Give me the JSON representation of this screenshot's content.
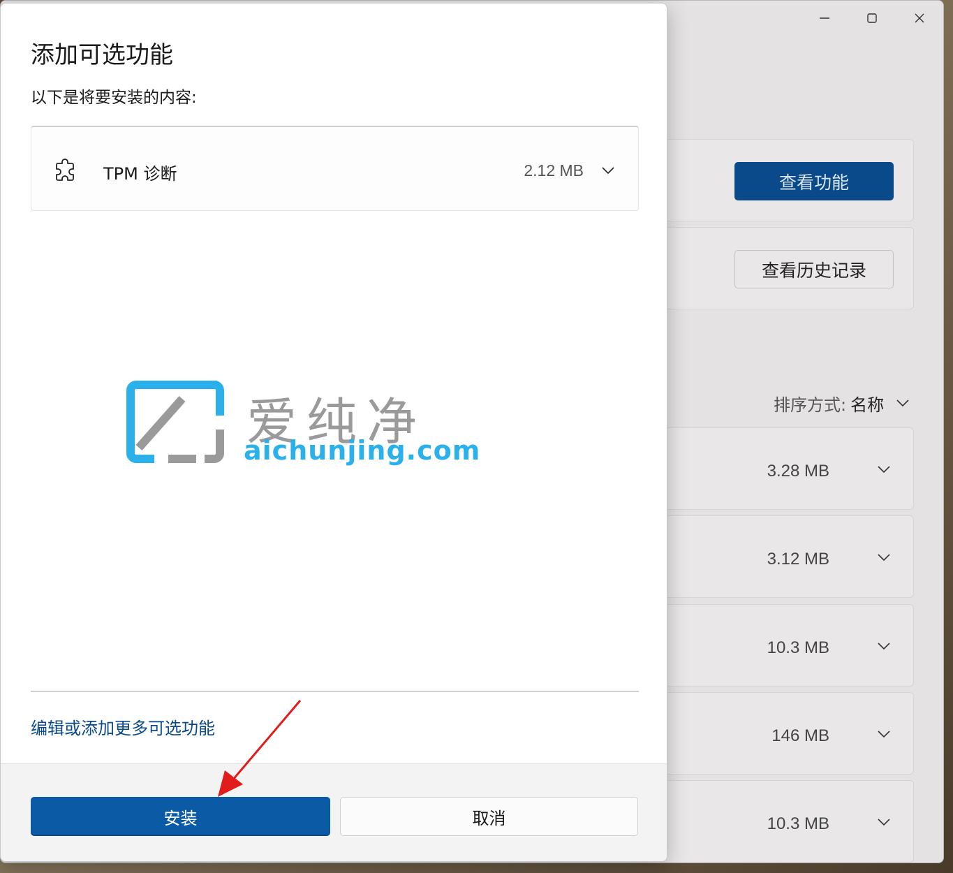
{
  "background_window": {
    "view_features_label": "查看功能",
    "view_history_label": "查看历史记录",
    "sort_label": "排序方式:",
    "sort_value": "名称",
    "items": [
      {
        "size": "3.28 MB"
      },
      {
        "size": "3.12 MB"
      },
      {
        "size": "10.3 MB"
      },
      {
        "size": "146 MB"
      },
      {
        "size": "10.3 MB"
      }
    ]
  },
  "dialog": {
    "title": "添加可选功能",
    "subtitle": "以下是将要安装的内容:",
    "features": [
      {
        "name": "TPM 诊断",
        "size": "2.12 MB",
        "icon": "puzzle-icon"
      }
    ],
    "more_link": "编辑或添加更多可选功能",
    "install_label": "安装",
    "cancel_label": "取消"
  },
  "watermark": {
    "cn": "爱纯净",
    "en": "aichunjing.com"
  },
  "colors": {
    "accent": "#0b5aa5",
    "link": "#0a4a8a",
    "annotation_arrow": "#e21b1b",
    "watermark_blue": "#2ab0ea"
  }
}
